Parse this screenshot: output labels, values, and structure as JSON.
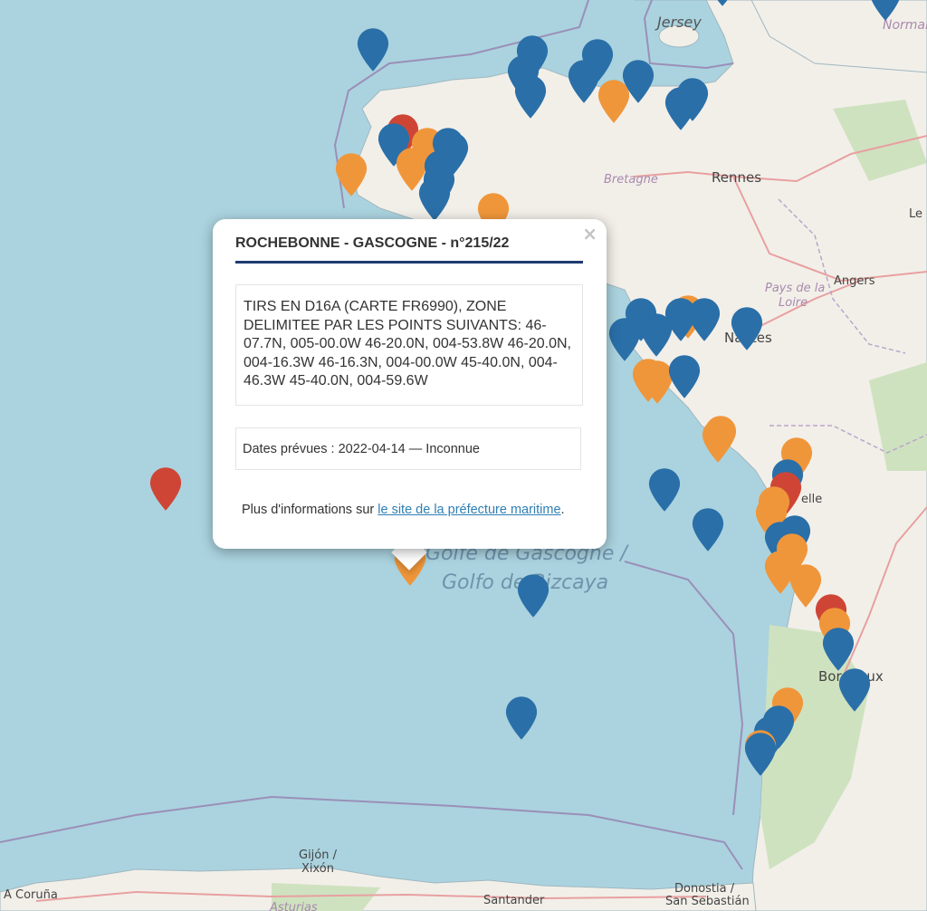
{
  "map": {
    "labels": {
      "jersey": "Jersey",
      "normandie": "Normar",
      "bretagne": "Bretagne",
      "rennes": "Rennes",
      "le_mans": "Le l",
      "angers": "Angers",
      "pays_de_la_loire_1": "Pays de la",
      "pays_de_la_loire_2": "Loire",
      "nantes": "Nantes",
      "la_rochelle": "elle",
      "golfe_1": "Golfe de Gascogne /",
      "golfe_2": "Golfo de Bizcaya",
      "bordeaux": "Bordeaux",
      "gijon_1": "Gijón /",
      "gijon_2": "Xixón",
      "coruna": "A Coruña",
      "asturias": "Asturias",
      "santander": "Santander",
      "donostia_1": "Donostia /",
      "donostia_2": "San Sebastián"
    },
    "colors": {
      "sea": "#aad3df",
      "land": "#f2efe9",
      "forest": "#add19e",
      "marker_blue": "#2a6fa8",
      "marker_orange": "#f0963a",
      "marker_red": "#cf4535"
    },
    "markers_note_icon": "map-marker-icon"
  },
  "popup": {
    "title": "ROCHEBONNE - GASCOGNE - n°215/22",
    "close_label": "×",
    "description": "TIRS EN D16A (CARTE FR6990), ZONE DELIMITEE PAR LES POINTS SUIVANTS: 46-07.7N, 005-00.0W 46-20.0N, 004-53.8W 46-20.0N, 004-16.3W 46-16.3N, 004-00.0W 45-40.0N, 004-46.3W 45-40.0N, 004-59.6W",
    "dates": "Dates prévues : 2022-04-14 — Inconnue",
    "more_prefix": "Plus d'informations sur ",
    "more_link": "le site de la préfecture maritime",
    "more_suffix": "."
  }
}
